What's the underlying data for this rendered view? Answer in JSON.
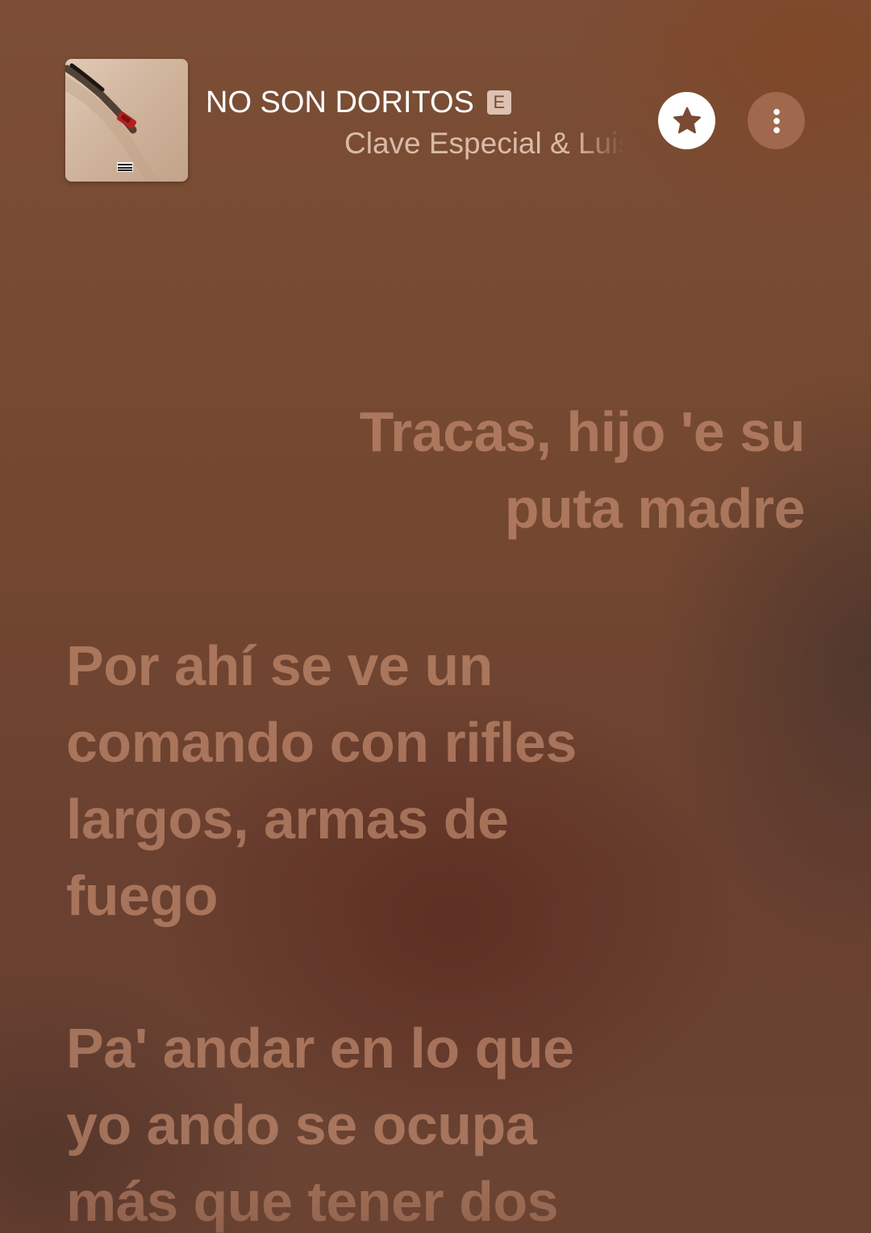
{
  "now_playing": {
    "title": "NO SON DORITOS",
    "explicit_badge": "E",
    "artist": "Clave Especial & Luis R Conriquez"
  },
  "icons": {
    "favorite": "star-icon",
    "more": "more-vertical-icon",
    "album_art": "album-artwork"
  },
  "colors": {
    "background": "#744830",
    "lyric_inactive": "#ce9478",
    "star_button_bg": "#ffffff",
    "star_glyph": "#7a4a34"
  },
  "lyrics": [
    {
      "lines": [
        "Tracas, hijo 'e su",
        "puta madre"
      ],
      "align": "right"
    },
    {
      "lines": [
        "Por ahí se ve un",
        "comando con rifles",
        "largos, armas de",
        "fuego"
      ],
      "align": "left"
    },
    {
      "lines": [
        "Pa' andar en lo que",
        "yo ando se ocupa",
        "más que tener dos"
      ],
      "align": "left"
    }
  ]
}
